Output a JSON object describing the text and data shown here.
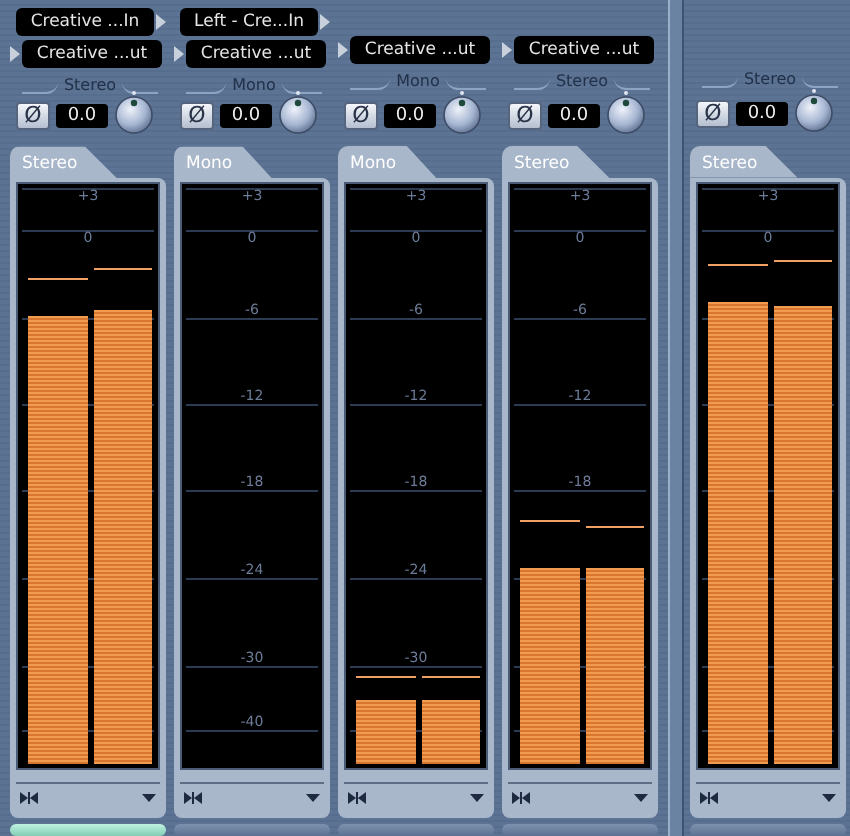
{
  "channels": [
    {
      "input_route": "Creative ...In",
      "output_route": "Creative ...ut",
      "mode": "Stereo",
      "phase": "Ø",
      "phase_inverted": false,
      "volume": "0.0",
      "tab": "Stereo",
      "scale": [
        "+3",
        "0"
      ],
      "selected": true,
      "meters": [
        {
          "level": 0.78,
          "peak_hold": {
            "level": 0.84
          }
        },
        {
          "level": 0.79,
          "peak_hold": {
            "level": 0.86
          }
        }
      ]
    },
    {
      "input_route": "Left - Cre...In",
      "output_route": "Creative ...ut",
      "mode": "Mono",
      "phase": "Ø",
      "phase_inverted": false,
      "volume": "0.0",
      "tab": "Mono",
      "scale": [
        "+3",
        "0",
        "-6",
        "-12",
        "-18",
        "-24",
        "-30",
        "-40"
      ],
      "selected": false
    },
    {
      "output_route": "Creative ...ut",
      "mode": "Mono",
      "phase": "Ø",
      "phase_inverted": false,
      "volume": "0.0",
      "tab": "Mono",
      "scale": [
        "+3",
        "0",
        "-6",
        "-12",
        "-18",
        "-24",
        "-30"
      ],
      "selected": false,
      "meters": [
        {
          "level": 0.11,
          "peak_hold": {
            "level": 0.15
          }
        },
        {
          "level": 0.11,
          "peak_hold": {
            "level": 0.15
          }
        }
      ]
    },
    {
      "output_route": "Creative ...ut",
      "mode": "Stereo",
      "phase": "Ø",
      "phase_inverted": false,
      "volume": "0.0",
      "tab": "Stereo",
      "scale": [
        "+3",
        "0",
        "-6",
        "-12",
        "-18"
      ],
      "selected": false,
      "meters": [
        {
          "level": 0.34,
          "peak_hold": {
            "level": 0.42
          }
        },
        {
          "level": 0.34,
          "peak_hold": {
            "level": 0.41
          }
        }
      ]
    }
  ],
  "master": {
    "mode": "Stereo",
    "phase": "Ø",
    "phase_inverted": false,
    "volume": "0.0",
    "tab": "Stereo",
    "scale": [
      "+3",
      "0"
    ],
    "selected": false,
    "meters": [
      {
        "level": 0.8,
        "peak_hold": {
          "level": 0.865
        }
      },
      {
        "level": 0.795,
        "peak_hold": {
          "level": 0.87
        }
      }
    ]
  }
}
